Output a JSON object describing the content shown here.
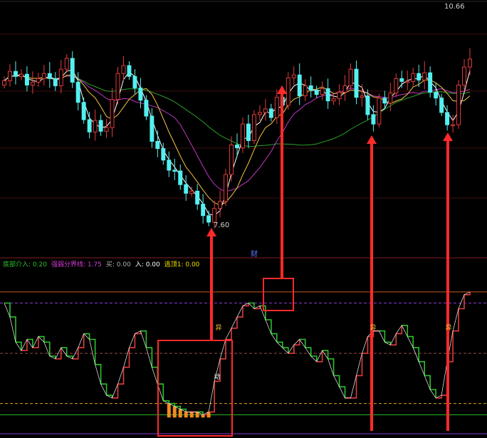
{
  "chart_data": [
    {
      "type": "candlestick",
      "title": "",
      "price_labels": {
        "high": "10.66",
        "low": "7.60"
      },
      "ma_colors": {
        "ma5": "#ffffff",
        "ma10": "#f5c542",
        "ma20": "#c236c2",
        "ma60": "#2aa02a"
      },
      "up_color": "#e23b3b",
      "down_color": "#54f0f0",
      "closes": [
        9.62,
        9.75,
        9.68,
        9.71,
        9.56,
        9.6,
        9.65,
        9.72,
        9.65,
        9.55,
        9.78,
        9.93,
        9.6,
        9.32,
        9.08,
        8.91,
        9.07,
        8.92,
        8.97,
        9.36,
        9.72,
        9.83,
        9.68,
        9.52,
        9.35,
        9.13,
        8.78,
        8.68,
        8.52,
        8.38,
        8.37,
        8.18,
        8.06,
        8.09,
        7.91,
        7.75,
        7.66,
        7.85,
        7.95,
        8.32,
        8.73,
        8.69,
        9.02,
        8.79,
        9.15,
        9.18,
        9.23,
        9.11,
        9.39,
        9.28,
        9.66,
        9.7,
        9.41,
        9.55,
        9.49,
        9.43,
        9.51,
        9.34,
        9.37,
        9.46,
        9.55,
        9.78,
        9.39,
        9.41,
        9.15,
        9.02,
        9.38,
        9.31,
        9.45,
        9.65,
        9.61,
        9.61,
        9.72,
        9.63,
        9.73,
        9.46,
        9.38,
        9.18,
        9.01,
        9.01,
        9.56,
        9.81,
        9.92
      ]
    },
    {
      "type": "line",
      "title": "",
      "legend": [
        {
          "label": "底部介入: 0.20",
          "color": "#29c229"
        },
        {
          "label": "强弱分界线: 1.75",
          "color": "#d63bd6"
        },
        {
          "label": "买: 0.00",
          "color": "#b0b0b0"
        },
        {
          "label": "入: 0.00",
          "color": "#ffffff"
        },
        {
          "label": "逃顶1: 0.00",
          "color": "#f0e000"
        }
      ],
      "cursor_label": "财",
      "ylim": [
        -0.2,
        2.3
      ],
      "levels": [
        {
          "name": "逃顶1",
          "value": 2.2,
          "color": "#c05a28"
        },
        {
          "name": "强弱分界线",
          "value": 2.0,
          "color": "#8a3dd6"
        },
        {
          "name": "mid",
          "value": 1.1,
          "color": "#9a4a4a"
        },
        {
          "name": "底部介入",
          "value": 0.2,
          "color": "#e0a020"
        },
        {
          "name": "zero",
          "value": 0.0,
          "color": "#29c229"
        }
      ],
      "markers": [
        "异",
        "异",
        "异",
        "动"
      ],
      "values": [
        2.0,
        1.75,
        1.3,
        1.15,
        1.35,
        1.2,
        1.4,
        1.3,
        1.05,
        1.0,
        1.2,
        1.05,
        1.0,
        1.2,
        1.45,
        1.35,
        0.9,
        0.55,
        0.35,
        0.3,
        0.55,
        0.85,
        1.2,
        1.45,
        1.5,
        1.2,
        0.85,
        0.55,
        0.25,
        0.2,
        0.15,
        0.1,
        0.05,
        0.05,
        0.05,
        0.0,
        0.05,
        0.6,
        1.0,
        1.35,
        1.55,
        1.75,
        1.95,
        2.0,
        1.9,
        1.95,
        1.7,
        1.45,
        1.3,
        1.2,
        1.1,
        1.25,
        1.35,
        1.2,
        1.05,
        0.95,
        1.15,
        1.0,
        0.7,
        0.5,
        0.3,
        0.3,
        0.7,
        1.1,
        1.4,
        1.5,
        1.5,
        1.3,
        1.25,
        1.45,
        1.6,
        1.4,
        1.2,
        0.95,
        0.7,
        0.45,
        0.3,
        0.35,
        0.95,
        1.5,
        1.9,
        2.15,
        2.2
      ]
    }
  ]
}
